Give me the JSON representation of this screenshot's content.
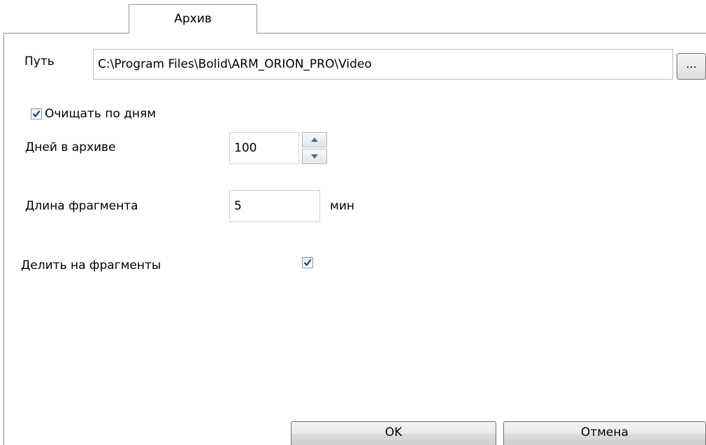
{
  "tab": {
    "label": "Архив"
  },
  "path": {
    "label": "Путь",
    "value": "C:\\Program Files\\Bolid\\ARM_ORION_PRO\\Video",
    "browse_label": "..."
  },
  "clean_by_days": {
    "label": "Очищать по  дням",
    "checked": true
  },
  "days_in_archive": {
    "label": "Дней в архиве",
    "value": "100"
  },
  "fragment_length": {
    "label": "Длина фрагмента",
    "value": "5",
    "unit": "мин"
  },
  "split_into_fragments": {
    "label": "Делить на фрагменты",
    "checked": true
  },
  "buttons": {
    "ok": "OK",
    "cancel": "Отмена"
  },
  "colors": {
    "check_mark": "#1d3d7a",
    "border": "#8e8f8f"
  }
}
